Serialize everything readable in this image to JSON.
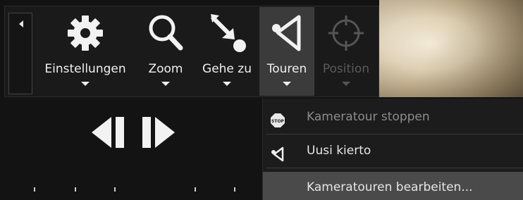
{
  "toolbar": {
    "collapse_icon": "triangle-left-icon",
    "tools": [
      {
        "label": "Einstellungen",
        "icon": "gear-icon",
        "state": "normal"
      },
      {
        "label": "Zoom",
        "icon": "magnifier-icon",
        "state": "normal"
      },
      {
        "label": "Gehe zu",
        "icon": "goto-arrow-icon",
        "state": "normal"
      },
      {
        "label": "Touren",
        "icon": "tour-icon",
        "state": "active"
      },
      {
        "label": "Position",
        "icon": "crosshair-icon",
        "state": "disabled"
      }
    ]
  },
  "playback": {
    "previous_icon": "step-back-icon",
    "next_icon": "step-forward-icon"
  },
  "tour_menu": {
    "items": [
      {
        "label": "Kameratour stoppen",
        "icon": "stop-sign-icon",
        "state": "disabled"
      },
      {
        "label": "Uusi kierto",
        "icon": "tour-icon",
        "state": "normal"
      },
      {
        "label": "Kameratouren bearbeiten...",
        "icon": "",
        "state": "highlighted"
      }
    ]
  },
  "colors": {
    "toolbar_bg": "#1a1a1a",
    "active_tool_bg": "#3b3b3b",
    "menu_bg": "#1c1c1c",
    "menu_highlight": "#4a4a4a",
    "text": "#f0f0f0",
    "disabled_text": "#5a5a5a"
  }
}
